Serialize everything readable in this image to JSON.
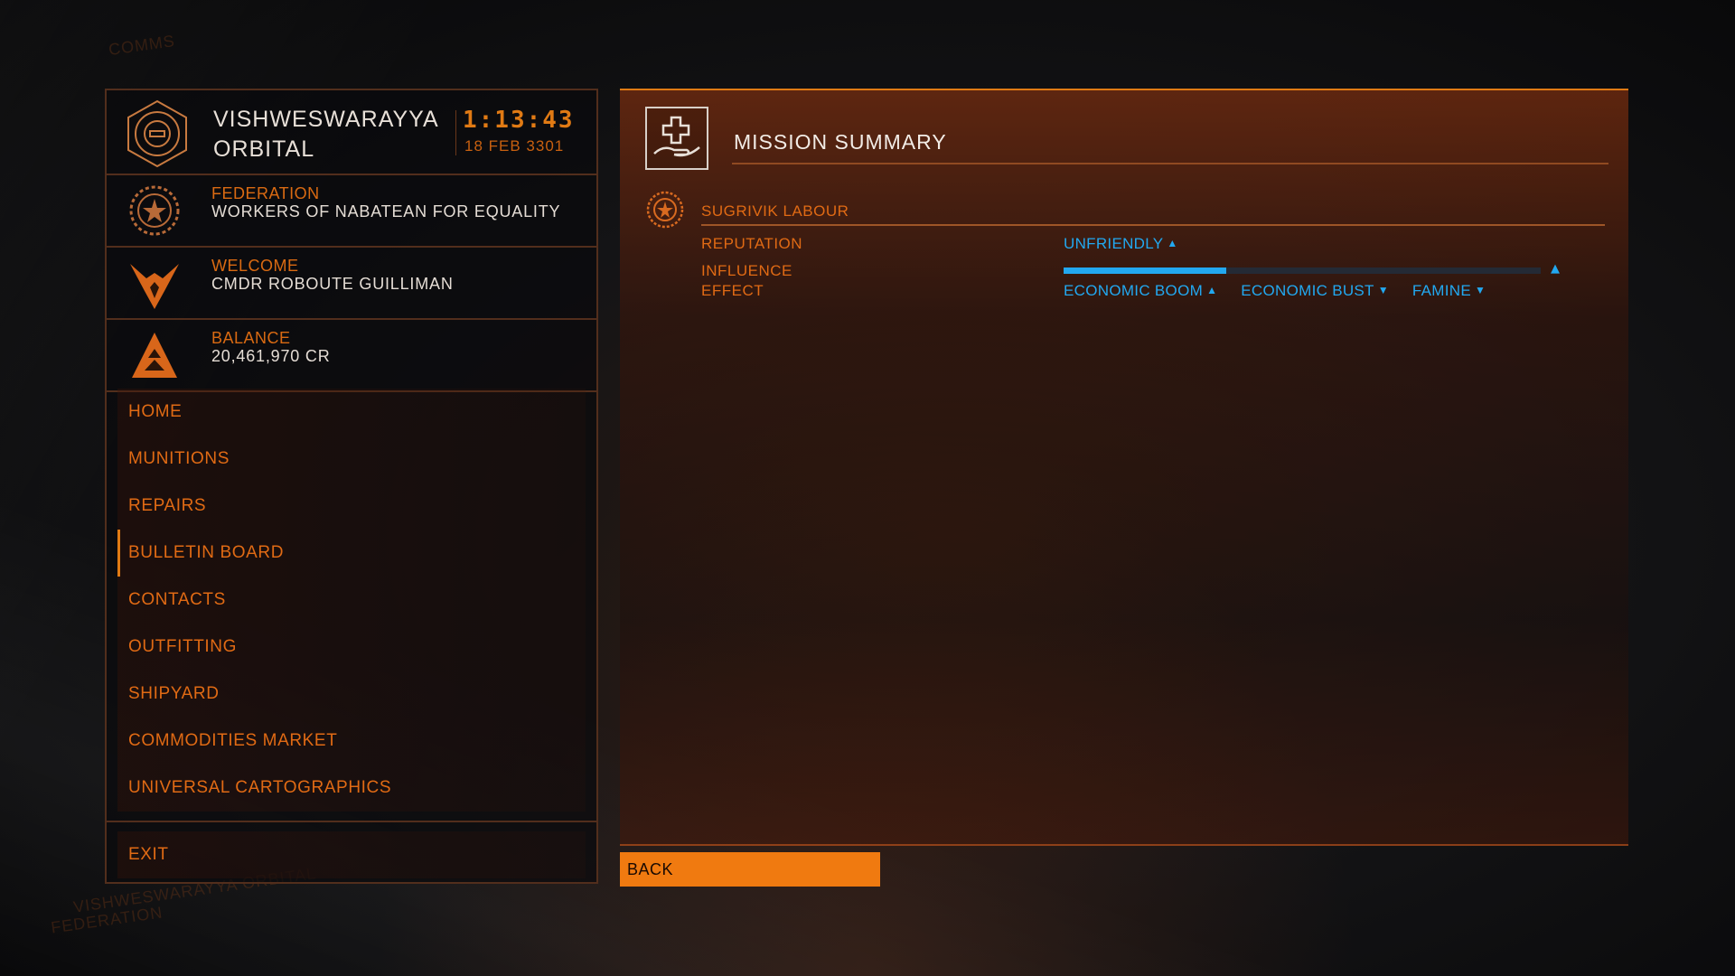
{
  "station": {
    "name_line1": "VISHWESWARAYYA",
    "name_line2": "ORBITAL",
    "time": "1:13:43",
    "date": "18 FEB 3301"
  },
  "faction": {
    "label": "FEDERATION",
    "value": "WORKERS OF NABATEAN FOR EQUALITY"
  },
  "welcome": {
    "label": "WELCOME",
    "value": "CMDR ROBOUTE GUILLIMAN"
  },
  "balance": {
    "label": "BALANCE",
    "value": "20,461,970 CR"
  },
  "nav": {
    "items": [
      {
        "label": "HOME"
      },
      {
        "label": "MUNITIONS"
      },
      {
        "label": "REPAIRS"
      },
      {
        "label": "BULLETIN BOARD",
        "active": true
      },
      {
        "label": "CONTACTS"
      },
      {
        "label": "OUTFITTING"
      },
      {
        "label": "SHIPYARD"
      },
      {
        "label": "COMMODITIES MARKET"
      },
      {
        "label": "UNIVERSAL CARTOGRAPHICS"
      }
    ],
    "exit_label": "EXIT"
  },
  "mission": {
    "title": "MISSION SUMMARY",
    "icon": "medical-aid-icon",
    "faction_name": "SUGRIVIK LABOUR",
    "reputation_label": "REPUTATION",
    "reputation_value": "UNFRIENDLY",
    "influence_label": "INFLUENCE",
    "influence_fraction": 0.34,
    "effect_label": "EFFECT",
    "effects": [
      {
        "label": "ECONOMIC BOOM",
        "direction": "up"
      },
      {
        "label": "ECONOMIC BUST",
        "direction": "down"
      },
      {
        "label": "FAMINE",
        "direction": "down"
      }
    ]
  },
  "back_label": "BACK",
  "background_labels": {
    "comms": "COMMS",
    "station": "VISHWESWARAYYA ORBITAL",
    "federation": "FEDERATION"
  },
  "colors": {
    "accent": "#e06a14",
    "highlight": "#22a8f0",
    "back_button": "#f07a10"
  }
}
